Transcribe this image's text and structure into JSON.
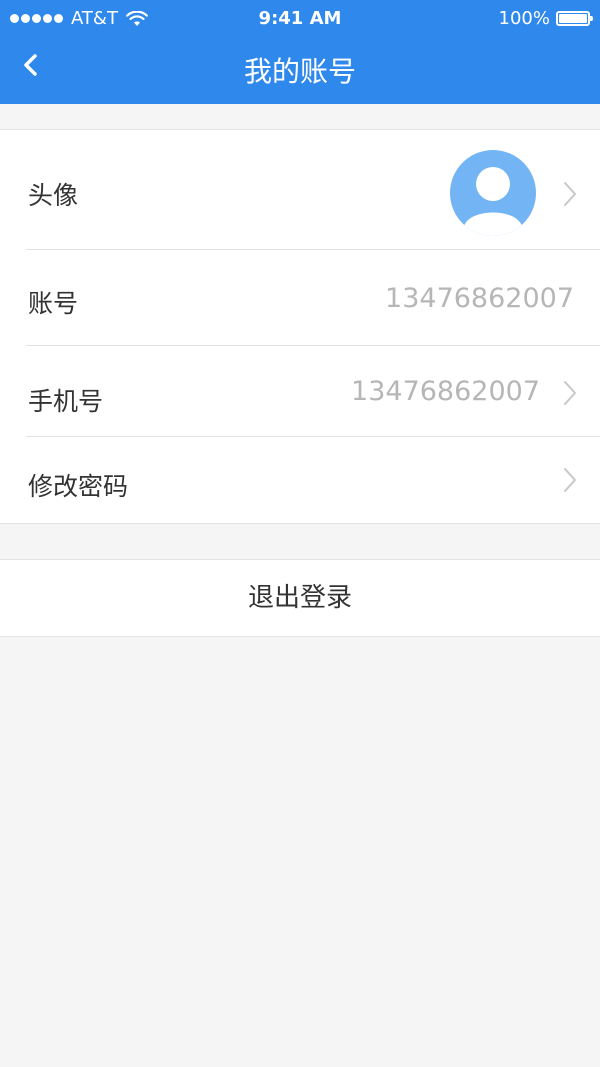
{
  "status_bar": {
    "carrier": "AT&T",
    "time": "9:41 AM",
    "battery": "100%",
    "icons": [
      "signal-dots-icon",
      "wifi-icon",
      "battery-icon"
    ]
  },
  "nav": {
    "title": "我的账号",
    "back_icon": "chevron-left-icon"
  },
  "account": {
    "avatar_label": "头像",
    "account_label": "账号",
    "account_value": "13476862007",
    "phone_label": "手机号",
    "phone_value": "13476862007",
    "password_label": "修改密码"
  },
  "logout_label": "退出登录",
  "colors": {
    "primary": "#2f88ec",
    "avatar_bg": "#72b4f4",
    "page_bg": "#f6f5f6"
  }
}
